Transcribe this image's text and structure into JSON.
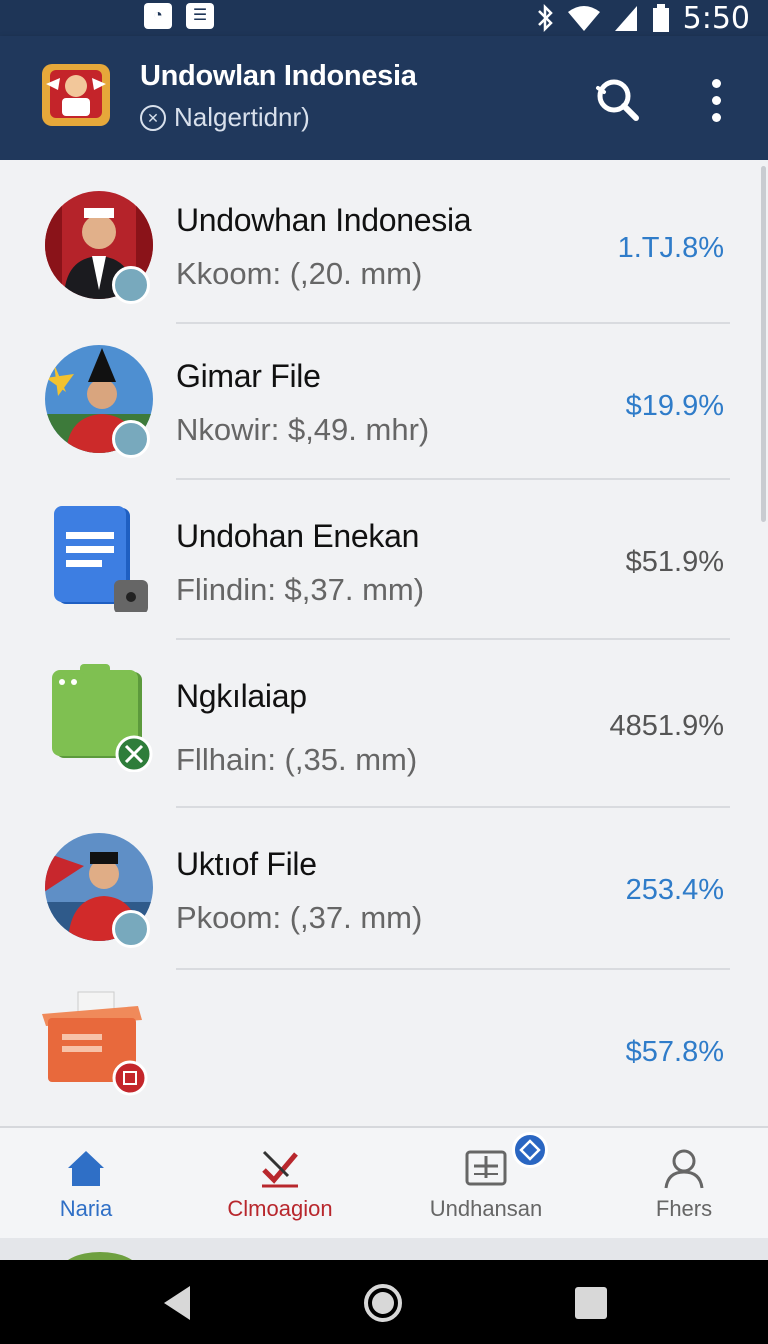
{
  "status_bar": {
    "time": "5:50"
  },
  "app_bar": {
    "title": "Undowlan Indonesia",
    "subtitle": "Nalgertidnr)"
  },
  "items": [
    {
      "name": "Undowhan Indonesia",
      "meta": "Kkoom: (,20. mm)",
      "value": "1.TJ.8%",
      "value_color": "blue",
      "thumb": "person-portrait"
    },
    {
      "name": "Gimar File",
      "meta": "Nkowir: $,49. mhr)",
      "value": "$19.9%",
      "value_color": "blue",
      "thumb": "person-portrait-sky"
    },
    {
      "name": "Undohan Enekan",
      "meta": "Flindin: $,37. mm)",
      "value": "$51.9%",
      "value_color": "gray",
      "thumb": "docs-icon"
    },
    {
      "name": "Ngkılaiap",
      "meta": "Fllhain: (,35. mm)",
      "value": "4851.9%",
      "value_color": "gray",
      "thumb": "green-bag-icon"
    },
    {
      "name": "Uktıof File",
      "meta": "Pkoom: (,37. mm)",
      "value": "253.4%",
      "value_color": "blue",
      "thumb": "person-portrait-red"
    },
    {
      "name": "",
      "meta": "",
      "value": "$57.8%",
      "value_color": "blue",
      "thumb": "box-icon"
    }
  ],
  "bottom_nav": [
    {
      "label": "Naria",
      "icon": "home-icon",
      "color": "#2f6fc6"
    },
    {
      "label": "Clmoagion",
      "icon": "check-mark-icon",
      "color": "#b8272d"
    },
    {
      "label": "Undhansan",
      "icon": "panel-icon",
      "color": "#666666"
    },
    {
      "label": "Fhers",
      "icon": "person-icon",
      "color": "#666666"
    }
  ],
  "colors": {
    "app_bar": "#20385c",
    "accent_blue": "#2f7cc9",
    "accent_red": "#b8272d"
  }
}
